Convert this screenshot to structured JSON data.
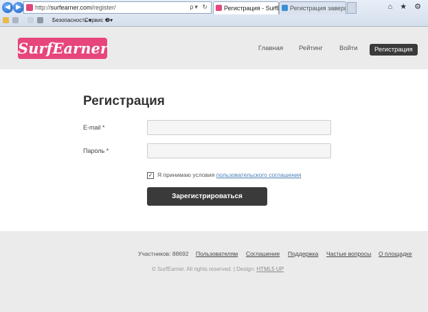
{
  "browser": {
    "url_prefix": "http://",
    "url_host": "surfearner.com",
    "url_path": "/register/",
    "controls": "ρ▾ ↻",
    "tabs": [
      {
        "label": "Регистрация - SurfEarner",
        "active": true
      },
      {
        "label": "Регистрация завершена на S...",
        "active": false
      }
    ],
    "window_icons": "⌂ ★ ⚙",
    "command_bar": {
      "safety": "Безопасность ▾",
      "service": "Сервис ▾",
      "help": "❷▾"
    }
  },
  "site": {
    "logo": "SurfEarner",
    "brand_color": "#e6467b",
    "nav": [
      "Главная",
      "Рейтинг",
      "Войти",
      "Регистрация"
    ]
  },
  "form": {
    "title": "Регистрация",
    "email_label": "E-mail *",
    "password_label": "Пароль *",
    "agree_prefix": "Я принимаю условия ",
    "agree_link": "пользовательского соглашения",
    "checked": true,
    "submit": "Зарегистрироваться"
  },
  "footer": {
    "users_stat": "Участников: 88692",
    "links": [
      "Пользователям",
      "Соглашение",
      "Поддержка",
      "Частые вопросы",
      "О площадке"
    ],
    "copyright": "© SurfEarner. All rights reserved. | Design: ",
    "design_link": "HTML5 UP"
  }
}
